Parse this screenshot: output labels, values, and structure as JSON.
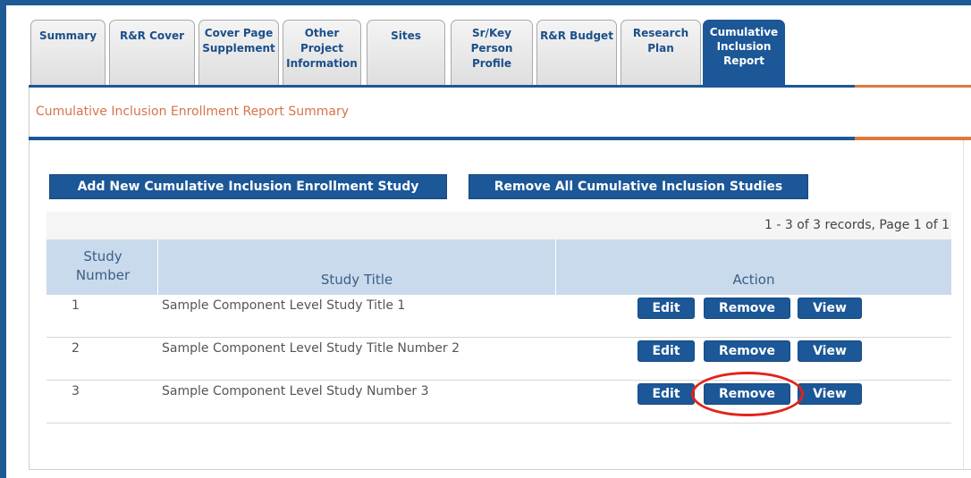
{
  "tabs": [
    {
      "label": "Summary"
    },
    {
      "label": "R&R Cover"
    },
    {
      "label": "Cover Page\nSupplement"
    },
    {
      "label": "Other\nProject\nInformation"
    },
    {
      "label": "Sites"
    },
    {
      "label": "Sr/Key\nPerson\nProfile"
    },
    {
      "label": "R&R Budget"
    },
    {
      "label": "Research\nPlan"
    },
    {
      "label": "Cumulative\nInclusion\nReport",
      "active": true
    }
  ],
  "section_title": "Cumulative Inclusion Enrollment Report Summary",
  "buttons": {
    "add_study": "Add New Cumulative Inclusion Enrollment Study",
    "remove_all": "Remove All Cumulative Inclusion Studies"
  },
  "records_text": "1 - 3 of 3 records, Page 1 of 1",
  "table": {
    "headers": {
      "study_number": "Study\nNumber",
      "study_title": "Study Title",
      "action": "Action"
    },
    "rows": [
      {
        "number": "1",
        "title": "Sample Component Level Study Title 1"
      },
      {
        "number": "2",
        "title": "Sample Component Level Study Title Number 2"
      },
      {
        "number": "3",
        "title": "Sample Component Level Study Number 3"
      }
    ],
    "actions": {
      "edit": "Edit",
      "remove": "Remove",
      "view": "View"
    }
  },
  "colors": {
    "primary_blue": "#1c5797",
    "accent_orange": "#e0793a",
    "highlight_red": "#e2231a",
    "header_bg": "#c9daec"
  }
}
